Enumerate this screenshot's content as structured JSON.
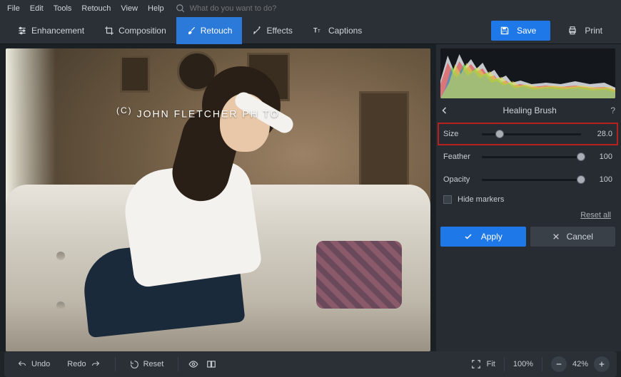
{
  "menu": {
    "items": [
      "File",
      "Edit",
      "Tools",
      "Retouch",
      "View",
      "Help"
    ],
    "search_placeholder": "What do you want to do?"
  },
  "toolbar": {
    "tabs": [
      {
        "label": "Enhancement",
        "icon": "sliders-icon"
      },
      {
        "label": "Composition",
        "icon": "crop-icon"
      },
      {
        "label": "Retouch",
        "icon": "brush-icon",
        "active": true
      },
      {
        "label": "Effects",
        "icon": "wand-icon"
      },
      {
        "label": "Captions",
        "icon": "text-icon"
      }
    ],
    "save_label": "Save",
    "print_label": "Print"
  },
  "canvas": {
    "watermark": "JOHN FLETCHER PH   TO",
    "watermark_prefix": "(C)"
  },
  "bottombar": {
    "undo": "Undo",
    "redo": "Redo",
    "reset": "Reset",
    "fit": "Fit",
    "zoom_pct": "100%",
    "zoom_out_pct": "42%"
  },
  "panel": {
    "title": "Healing Brush",
    "sliders": [
      {
        "label": "Size",
        "value": "28.0",
        "pos": 18,
        "highlight": true
      },
      {
        "label": "Feather",
        "value": "100",
        "pos": 100
      },
      {
        "label": "Opacity",
        "value": "100",
        "pos": 100
      }
    ],
    "hide_markers": "Hide markers",
    "reset_all": "Reset all",
    "apply": "Apply",
    "cancel": "Cancel"
  }
}
